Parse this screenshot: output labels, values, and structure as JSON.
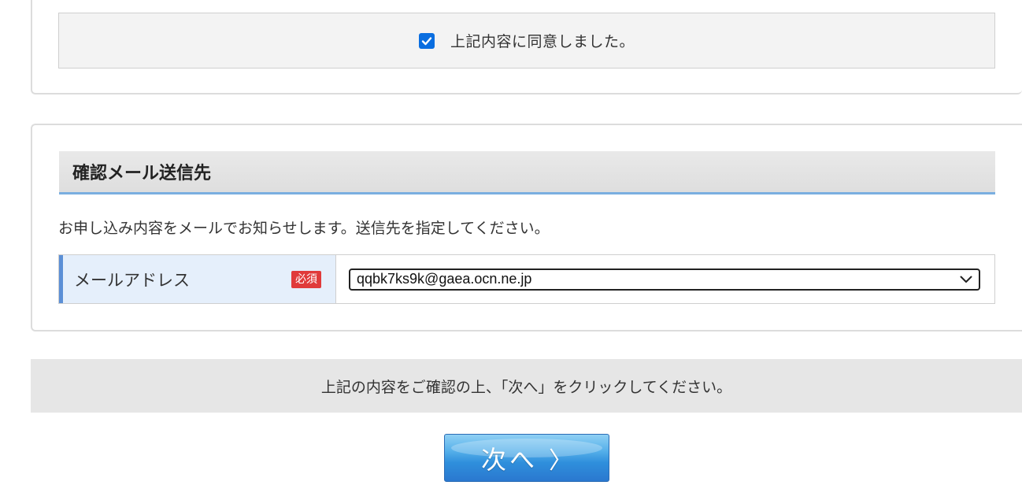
{
  "agreement": {
    "checked": true,
    "label": "上記内容に同意しました。"
  },
  "mail_section": {
    "title": "確認メール送信先",
    "description": "お申し込み内容をメールでお知らせします。送信先を指定してください。",
    "field_label": "メールアドレス",
    "required_badge": "必須",
    "selected_email": "qqbk7ks9k@gaea.ocn.ne.jp"
  },
  "instruction": {
    "text": "上記の内容をご確認の上、「次へ」をクリックしてください。"
  },
  "next_button": {
    "label": "次へ",
    "arrow": "〉"
  },
  "colors": {
    "checkbox": "#0a6ee0",
    "required_badge": "#e03a3a",
    "section_accent": "#7aaee0",
    "label_cell": "#e5effb",
    "button_blue": "#2f8fdc"
  },
  "icons": {
    "checkbox": "checkmark-icon",
    "select": "chevron-down-icon",
    "button": "chevron-right-icon"
  }
}
